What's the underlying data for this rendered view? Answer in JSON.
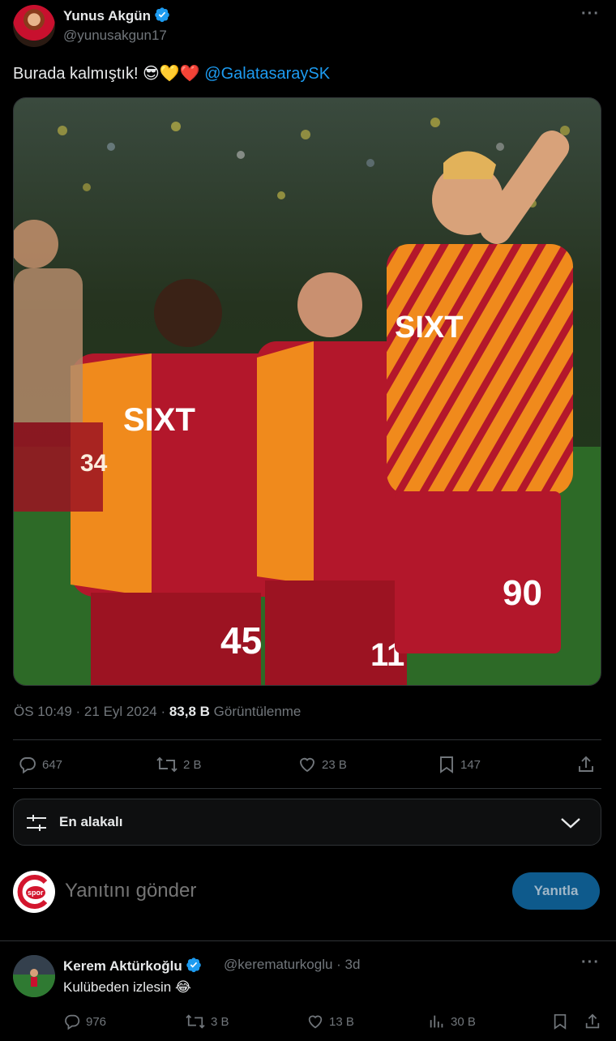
{
  "tweet": {
    "author_name": "Yunus Akgün",
    "handle": "@yunusakgun17",
    "more": "···",
    "text": "Burada kalmıştık! 😎💛❤️",
    "mention": "@GalatasaraySK",
    "photo_alt": "Galatasaray players celebrating",
    "time": "ÖS 10:49 · 21 Eyl 2024 · ",
    "views_count": "83,8 B",
    "views_label": " Görüntülenme",
    "actions": {
      "replies": "647",
      "retweets": "2 B",
      "likes": "23 B",
      "bookmarks": "147"
    },
    "jersey_numbers": [
      "45",
      "11",
      "90",
      "34"
    ],
    "sponsor": "SIXT"
  },
  "filter": {
    "label": "En alakalı"
  },
  "composer": {
    "placeholder": "Yanıtını gönder",
    "reply_button": "Yanıtla",
    "avatar_text": "spor"
  },
  "reply": {
    "author_name": "Kerem Aktürkoğlu",
    "handle": "@kerematurkoglu · 3d",
    "text": "Kulübeden izlesin 😂",
    "more": "···",
    "actions": {
      "replies": "976",
      "retweets": "3 B",
      "likes": "13 B",
      "views": "30 B"
    }
  },
  "colors": {
    "background": "#000000",
    "accent": "#1d9bf0",
    "muted": "#71767b",
    "reply_button": "#0e5a8c",
    "galatasaray_red": "#b3172b",
    "galatasaray_orange": "#f08a1c"
  }
}
